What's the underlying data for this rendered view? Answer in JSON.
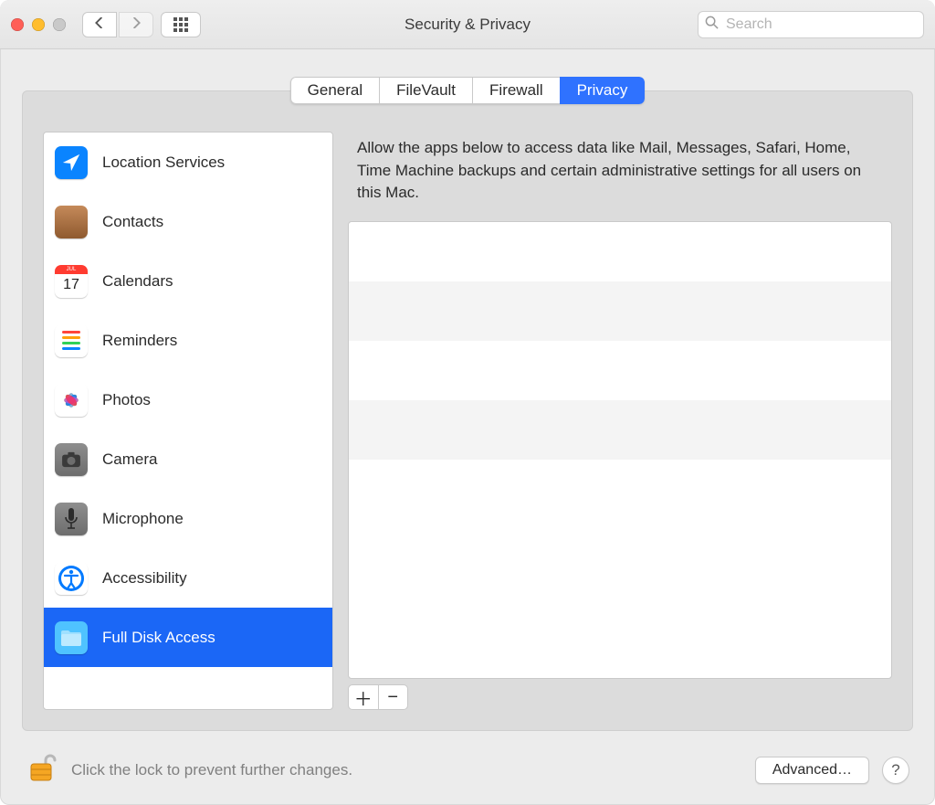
{
  "window": {
    "title": "Security & Privacy"
  },
  "search": {
    "placeholder": "Search"
  },
  "tabs": [
    {
      "label": "General",
      "selected": false
    },
    {
      "label": "FileVault",
      "selected": false
    },
    {
      "label": "Firewall",
      "selected": false
    },
    {
      "label": "Privacy",
      "selected": true
    }
  ],
  "sidebar": {
    "items": [
      {
        "label": "Location Services",
        "icon": "location-icon"
      },
      {
        "label": "Contacts",
        "icon": "contacts-icon"
      },
      {
        "label": "Calendars",
        "icon": "calendars-icon"
      },
      {
        "label": "Reminders",
        "icon": "reminders-icon"
      },
      {
        "label": "Photos",
        "icon": "photos-icon"
      },
      {
        "label": "Camera",
        "icon": "camera-icon"
      },
      {
        "label": "Microphone",
        "icon": "microphone-icon"
      },
      {
        "label": "Accessibility",
        "icon": "accessibility-icon"
      },
      {
        "label": "Full Disk Access",
        "icon": "folder-icon",
        "selected": true
      }
    ]
  },
  "calendar_icon": {
    "month": "JUL",
    "day": "17"
  },
  "panel": {
    "description": "Allow the apps below to access data like Mail, Messages, Safari, Home, Time Machine backups and certain administrative settings for all users on this Mac."
  },
  "footer": {
    "lock_text": "Click the lock to prevent further changes.",
    "advanced_label": "Advanced…",
    "help_label": "?"
  }
}
